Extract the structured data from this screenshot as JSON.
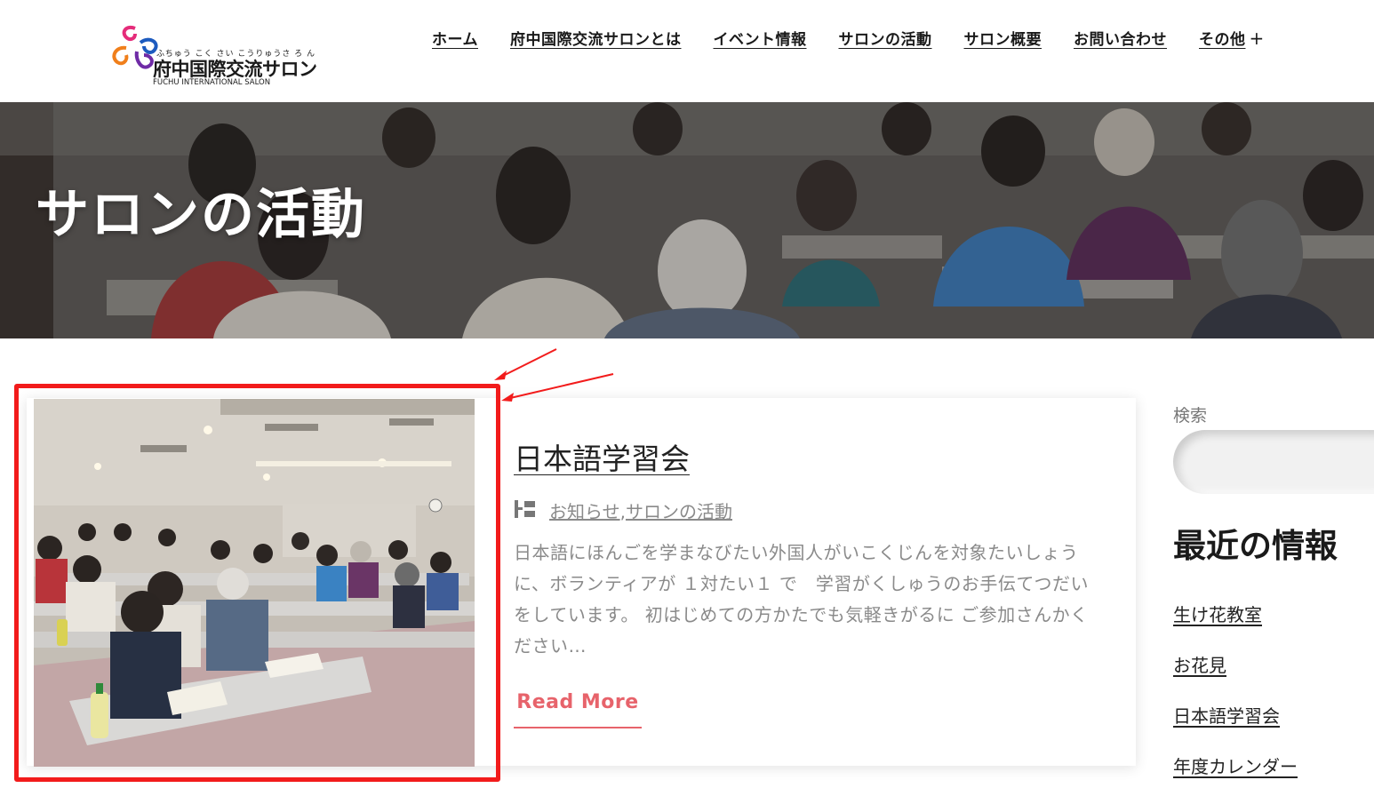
{
  "header": {
    "logo": {
      "ruby": "ふちゅう こく さい こうりゅうさ ろ ん",
      "name": "府中国際交流サロン",
      "subtitle": "FUCHU INTERNATIONAL SALON"
    },
    "nav": [
      {
        "label": "ホーム"
      },
      {
        "label": "府中国際交流サロンとは"
      },
      {
        "label": "イベント情報"
      },
      {
        "label": "サロンの活動"
      },
      {
        "label": "サロン概要"
      },
      {
        "label": "お問い合わせ"
      },
      {
        "label": "その他",
        "suffix": "+"
      }
    ]
  },
  "hero": {
    "title": "サロンの活動"
  },
  "post": {
    "title": "日本語学習会",
    "categories": [
      "お知らせ",
      "サロンの活動"
    ],
    "category_separator": ",",
    "excerpt": "日本語にほんごを学まなびたい外国人がいこくじんを対象たいしょうに、ボランティアが １対たい１ で　学習がくしゅうのお手伝てつだいをしています。 初はじめての方かたでも気軽きがるに ご参加さんかください…",
    "read_more": "Read More"
  },
  "sidebar": {
    "search_label": "検索",
    "recent_title": "最近の情報",
    "recent_items": [
      {
        "label": "生け花教室"
      },
      {
        "label": "お花見"
      },
      {
        "label": "日本語学習会"
      },
      {
        "label": "年度カレンダー"
      }
    ]
  },
  "colors": {
    "accent": "#e7636b",
    "highlight_border": "#f21b1b",
    "text_muted": "#8a8a8a"
  }
}
